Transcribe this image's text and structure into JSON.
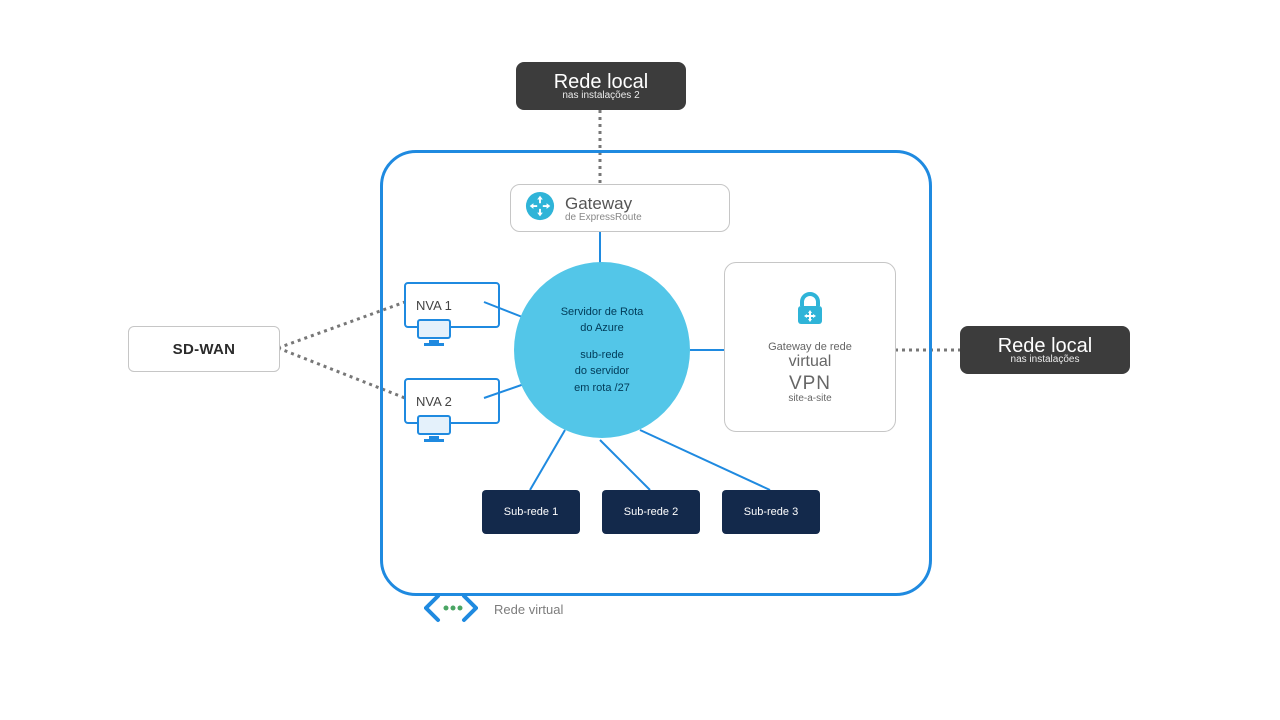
{
  "onprem2": {
    "title": "Rede local",
    "sub": "nas instalações 2"
  },
  "onprem1": {
    "title": "Rede local",
    "sub": "nas instalações"
  },
  "sdwan": {
    "label": "SD-WAN"
  },
  "gateway": {
    "title": "Gateway",
    "sub": "de ExpressRoute"
  },
  "nva1": "NVA 1",
  "nva2": "NVA 2",
  "routeserver": {
    "l1": "Servidor de Rota",
    "l2": "do Azure",
    "l3": "sub-rede",
    "l4": "do servidor",
    "l5": "em rota /27"
  },
  "vpn": {
    "l1": "Gateway de rede",
    "l2": "virtual",
    "l3": "VPN",
    "l4": "site-a-site"
  },
  "subnets": [
    "Sub-rede 1",
    "Sub-rede 2",
    "Sub-rede 3"
  ],
  "vnetLabel": "Rede virtual",
  "colors": {
    "azure": "#1f8ae0",
    "circle": "#53c6e8",
    "navy": "#13294b",
    "dark": "#3c3c3c"
  }
}
